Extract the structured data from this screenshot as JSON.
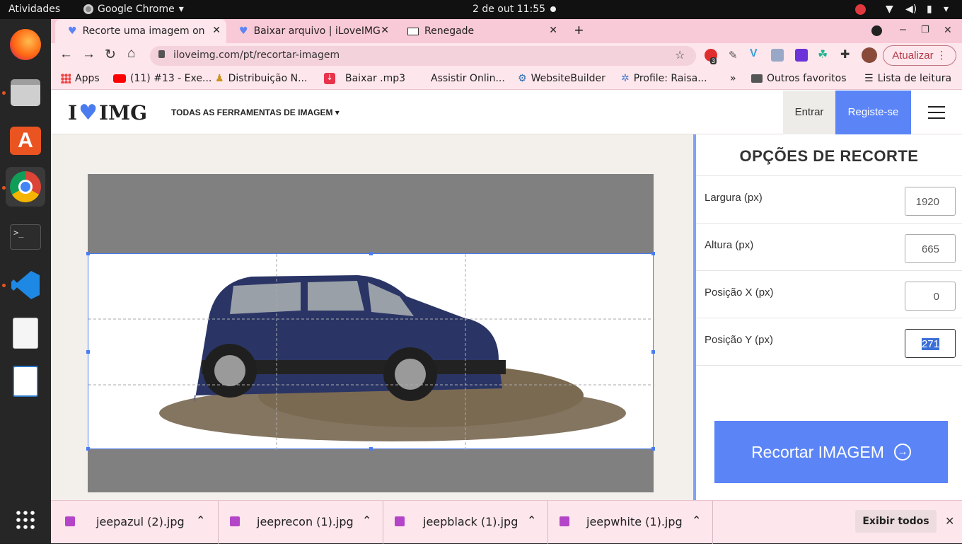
{
  "system": {
    "activities": "Atividades",
    "app_name": "Google Chrome",
    "clock": "2 de out  11:55"
  },
  "tabs": [
    {
      "title": "Recorte uma imagem onli",
      "active": true
    },
    {
      "title": "Baixar arquivo | iLoveIMG",
      "active": false
    },
    {
      "title": "Renegade",
      "active": false
    }
  ],
  "new_tab": "+",
  "address": {
    "url": "iloveimg.com/pt/recortar-imagem"
  },
  "toolbar": {
    "update_label": "Atualizar",
    "ext_badge": "3"
  },
  "bookmarks": [
    {
      "label": "Apps"
    },
    {
      "label": "(11) #13 - Exe..."
    },
    {
      "label": "Distribuição N..."
    },
    {
      "label": "Baixar .mp3"
    },
    {
      "label": "Assistir Onlin..."
    },
    {
      "label": "WebsiteBuilder"
    },
    {
      "label": "Profile: Raisa..."
    },
    {
      "label": "»"
    },
    {
      "label": "Outros favoritos"
    },
    {
      "label": "Lista de leitura"
    }
  ],
  "site": {
    "logo_left": "I",
    "logo_right": "IMG",
    "nav_tools": "TODAS AS FERRAMENTAS DE IMAGEM",
    "login": "Entrar",
    "signup": "Registe-se"
  },
  "panel": {
    "title": "OPÇÕES DE RECORTE",
    "fields": [
      {
        "label": "Largura (px)",
        "value": "1920"
      },
      {
        "label": "Altura (px)",
        "value": "665"
      },
      {
        "label": "Posição X (px)",
        "value": "0"
      },
      {
        "label": "Posição Y (px)",
        "value": "271"
      }
    ],
    "crop_button": "Recortar IMAGEM"
  },
  "downloads": {
    "files": [
      {
        "name": "jeepazul (2).jpg"
      },
      {
        "name": "jeeprecon (1).jpg"
      },
      {
        "name": "jeepblack (1).jpg"
      },
      {
        "name": "jeepwhite (1).jpg"
      }
    ],
    "show_all": "Exibir todos"
  },
  "colors": {
    "accent": "#5b85f7",
    "tabstrip": "#f8c9d6",
    "toolbar": "#fde6ec"
  }
}
